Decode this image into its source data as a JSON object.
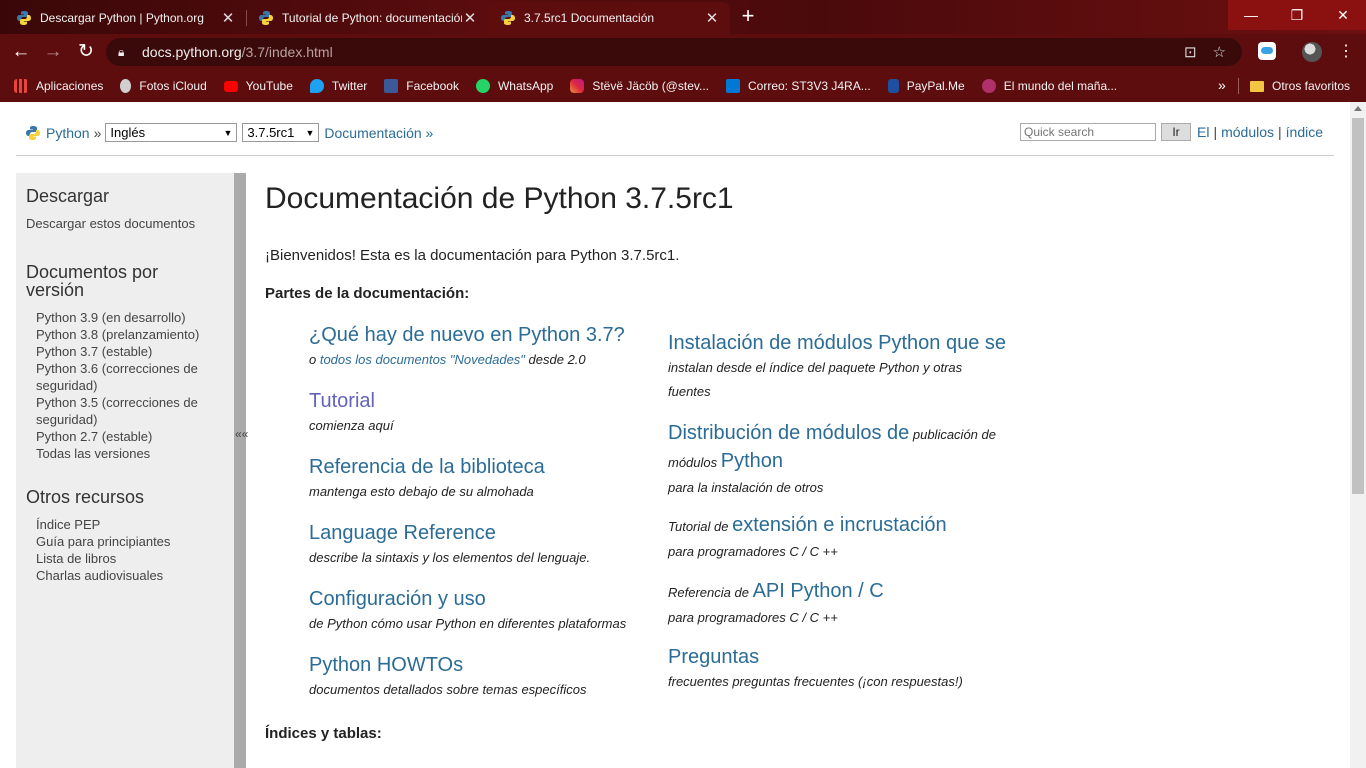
{
  "browser": {
    "tabs": [
      {
        "title": "Descargar Python | Python.org",
        "active": false
      },
      {
        "title": "Tutorial de Python: documentación",
        "active": false
      },
      {
        "title": "3.7.5rc1 Documentación",
        "active": true
      }
    ],
    "url_host": "docs.python.org",
    "url_path": "/3.7/index.html",
    "bookmarks": [
      {
        "label": "Aplicaciones",
        "icon": "apps-grid-icon",
        "color": "#e8453c"
      },
      {
        "label": "Fotos iCloud",
        "icon": "apple-icon",
        "color": "#cccccc"
      },
      {
        "label": "YouTube",
        "icon": "youtube-icon",
        "color": "#ff0000"
      },
      {
        "label": "Twitter",
        "icon": "twitter-icon",
        "color": "#1da1f2"
      },
      {
        "label": "Facebook",
        "icon": "facebook-icon",
        "color": "#3b5998"
      },
      {
        "label": "WhatsApp",
        "icon": "whatsapp-icon",
        "color": "#25d366"
      },
      {
        "label": "Stëvë Jäcöb (@stev...",
        "icon": "instagram-icon",
        "color": "#c13584"
      },
      {
        "label": "Correo: ST3V3 J4RA...",
        "icon": "outlook-icon",
        "color": "#0078d4"
      },
      {
        "label": "PayPal.Me",
        "icon": "paypal-icon",
        "color": "#003087"
      },
      {
        "label": "El mundo del maña...",
        "icon": "site-icon",
        "color": "#b0306a"
      }
    ],
    "other_bookmarks": "Otros favoritos",
    "more": "»"
  },
  "header": {
    "home": "Python",
    "sep": "»",
    "language_select": "Inglés",
    "version_select": "3.7.5rc1",
    "doc_crumb": "Documentación »",
    "search_placeholder": "Quick search",
    "search_button": "Ir",
    "links": [
      "El",
      "módulos",
      "índice"
    ]
  },
  "sidebar": {
    "download_title": "Descargar",
    "download_link": "Descargar estos documentos",
    "versions_title_line1": "Documentos por",
    "versions_title_line2": "versión",
    "versions": [
      "Python 3.9 (en desarrollo)",
      "Python 3.8 (prelanzamiento)",
      "Python 3.7 (estable)",
      "Python 3.6 (correcciones de",
      "seguridad)",
      "Python 3.5 (correcciones de",
      "seguridad)",
      "Python 2.7 (estable)",
      "Todas las versiones"
    ],
    "resources_title": "Otros recursos",
    "resources": [
      "Índice PEP",
      "Guía para principiantes",
      "Lista de libros",
      "Charlas audiovisuales"
    ],
    "collapse": "««"
  },
  "main": {
    "title": "Documentación de Python 3.7.5rc1",
    "welcome": "¡Bienvenidos! Esta es la documentación para Python 3.7.5rc1.",
    "parts_title": "Partes de la documentación:",
    "indices_title": "Índices y tablas:",
    "left": {
      "whatsnew": "¿Qué hay de nuevo en Python 3.7?",
      "whatsnew_pre": "o ",
      "whatsnew_link": "todos los documentos \"Novedades\"",
      "whatsnew_post": " desde 2.0",
      "tutorial": "Tutorial",
      "tutorial_desc": "comienza aquí",
      "library": "Referencia de la biblioteca",
      "library_desc": "mantenga esto debajo de su almohada",
      "langref": "Language Reference",
      "langref_desc": "describe la sintaxis y los elementos del lenguaje.",
      "setup": "Configuración y uso",
      "setup_desc": "de Python cómo usar Python en diferentes plataformas",
      "howto": "Python HOWTOs",
      "howto_desc": "documentos detallados sobre temas específicos"
    },
    "right": {
      "installing": "Instalación de módulos Python que se",
      "installing_desc1": "instalan desde el índice del paquete Python y otras",
      "installing_desc2": "fuentes",
      "distrib_a": "Distribución de módulos de",
      "distrib_small1": " publicación de",
      "distrib_small2": "módulos ",
      "distrib_b": "Python",
      "distrib_desc": "para la instalación de otros",
      "extending_pre": "Tutorial de ",
      "extending": "extensión e incrustación",
      "extending_desc": "para programadores C / C ++",
      "capi_pre": "Referencia de ",
      "capi": "API Python / C",
      "capi_desc": "para programadores C / C ++",
      "faq": "Preguntas",
      "faq_desc": "frecuentes preguntas frecuentes (¡con respuestas!)"
    }
  }
}
